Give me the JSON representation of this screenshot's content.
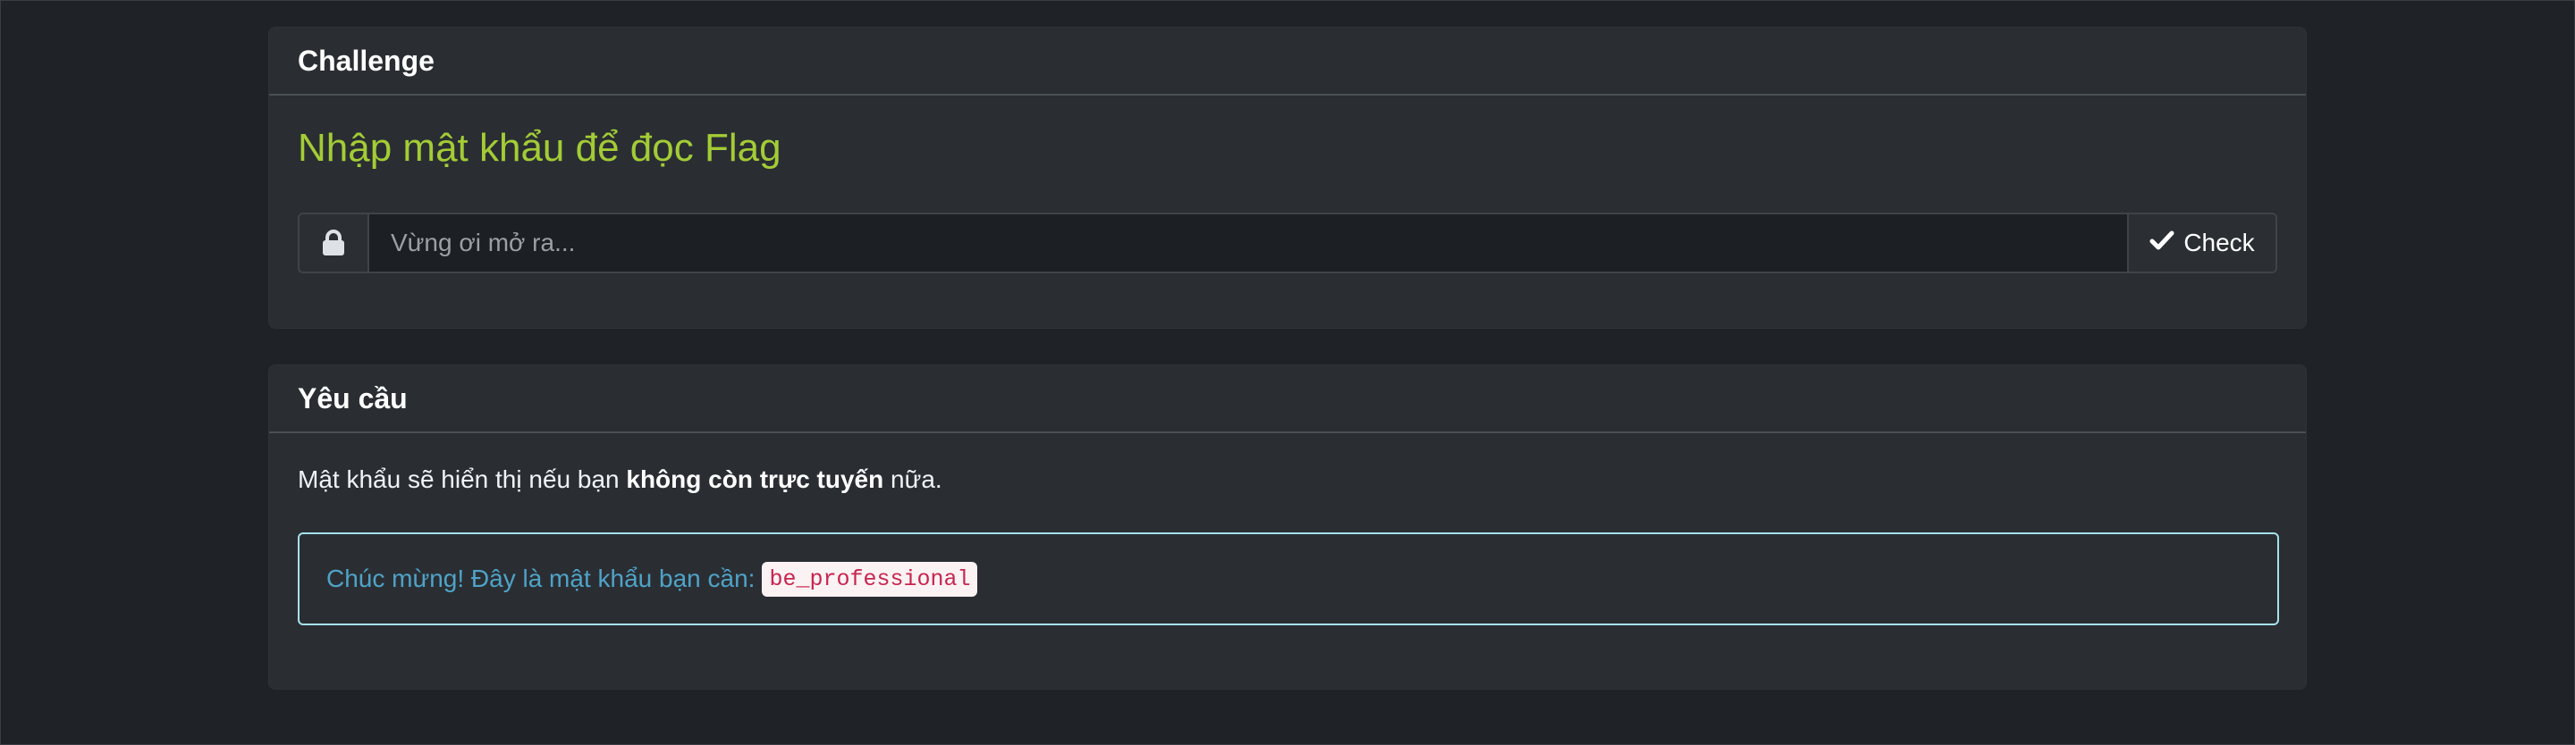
{
  "challenge_card": {
    "header": "Challenge",
    "title": "Nhập mật khẩu để đọc Flag",
    "lock_icon": "lock-icon",
    "input_placeholder": "Vừng ơi mở ra...",
    "input_value": "",
    "check_icon": "checkmark-icon",
    "check_label": "Check",
    "title_color": "#a3cc35"
  },
  "requirements_card": {
    "header": "Yêu cầu",
    "text_before": "Mật khẩu sẽ hiển thị nếu bạn ",
    "text_bold": "không còn trực tuyến",
    "text_after": " nữa.",
    "alert_text": "Chúc mừng! Đây là mật khẩu bạn cần:",
    "password_code": "be_professional",
    "alert_color": "#4fa3c7",
    "code_color": "#c7254e"
  }
}
